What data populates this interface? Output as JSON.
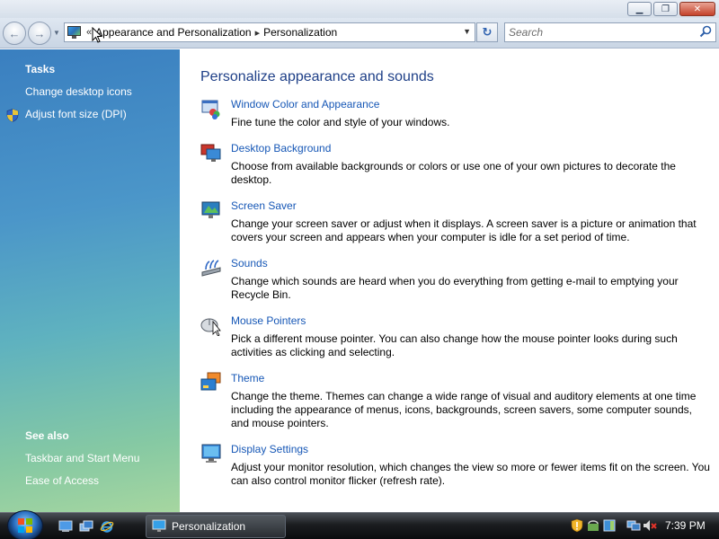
{
  "window": {
    "controls": {
      "minimize": "▁",
      "maximize": "❐",
      "close": "✕"
    }
  },
  "navbar": {
    "back_glyph": "←",
    "forward_glyph": "→",
    "overflow": "«",
    "breadcrumb": [
      "Appearance and Personalization",
      "Personalization"
    ],
    "separator": "▸",
    "refresh_glyph": "↻",
    "search_placeholder": "Search"
  },
  "sidebar": {
    "tasks_heading": "Tasks",
    "tasks": [
      "Change desktop icons",
      "Adjust font size (DPI)"
    ],
    "see_also_heading": "See also",
    "see_also": [
      "Taskbar and Start Menu",
      "Ease of Access"
    ]
  },
  "main": {
    "title": "Personalize appearance and sounds",
    "items": [
      {
        "icon": "window-color-icon",
        "label": "Window Color and Appearance",
        "description": "Fine tune the color and style of your windows."
      },
      {
        "icon": "desktop-background-icon",
        "label": "Desktop Background",
        "description": "Choose from available backgrounds or colors or use one of your own pictures to decorate the desktop."
      },
      {
        "icon": "screen-saver-icon",
        "label": "Screen Saver",
        "description": "Change your screen saver or adjust when it displays. A screen saver is a picture or animation that covers your screen and appears when your computer is idle for a set period of time."
      },
      {
        "icon": "sounds-icon",
        "label": "Sounds",
        "description": "Change which sounds are heard when you do everything from getting e-mail to emptying your Recycle Bin."
      },
      {
        "icon": "mouse-pointers-icon",
        "label": "Mouse Pointers",
        "description": "Pick a different mouse pointer. You can also change how the mouse pointer looks during such activities as clicking and selecting."
      },
      {
        "icon": "theme-icon",
        "label": "Theme",
        "description": "Change the theme. Themes can change a wide range of visual and auditory elements at one time including the appearance of menus, icons, backgrounds, screen savers, some computer sounds, and mouse pointers."
      },
      {
        "icon": "display-settings-icon",
        "label": "Display Settings",
        "description": "Adjust your monitor resolution, which changes the view so more or fewer items fit on the screen. You can also control monitor flicker (refresh rate)."
      }
    ]
  },
  "taskbar": {
    "active_window": "Personalization",
    "clock": "7:39 PM"
  },
  "colors": {
    "link": "#1657b6",
    "title": "#1e3f87",
    "sidebar_top": "#3a7fc0",
    "sidebar_bottom": "#a6d6a0"
  }
}
